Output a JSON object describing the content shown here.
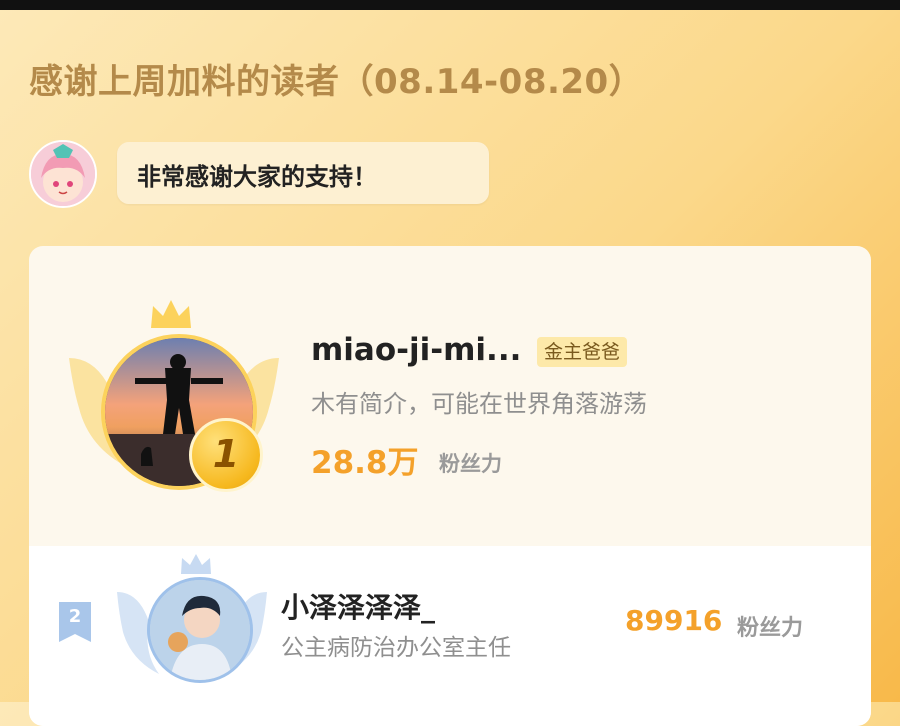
{
  "header": {
    "title": "感谢上周加料的读者（08.14-08.20）"
  },
  "message": {
    "mascot_icon": "mascot-avatar-icon",
    "text": "非常感谢大家的支持！"
  },
  "ranking": [
    {
      "rank": "1",
      "name": "miao-ji-mi...",
      "tag": "金主爸爸",
      "bio": "木有简介，可能在世界角落游荡",
      "fans_value": "28.8万",
      "fans_label": "粉丝力",
      "icon": "crown-icon"
    },
    {
      "rank": "2",
      "name": "小泽泽泽泽_",
      "bio": "公主病防治办公室主任",
      "fans_value": "89916",
      "fans_label": "粉丝力",
      "icon": "crown-icon"
    }
  ],
  "colors": {
    "accent": "#f4a12a",
    "gold": "#f6b81e",
    "silver": "#9fc1ea",
    "title": "#b48a4a"
  }
}
